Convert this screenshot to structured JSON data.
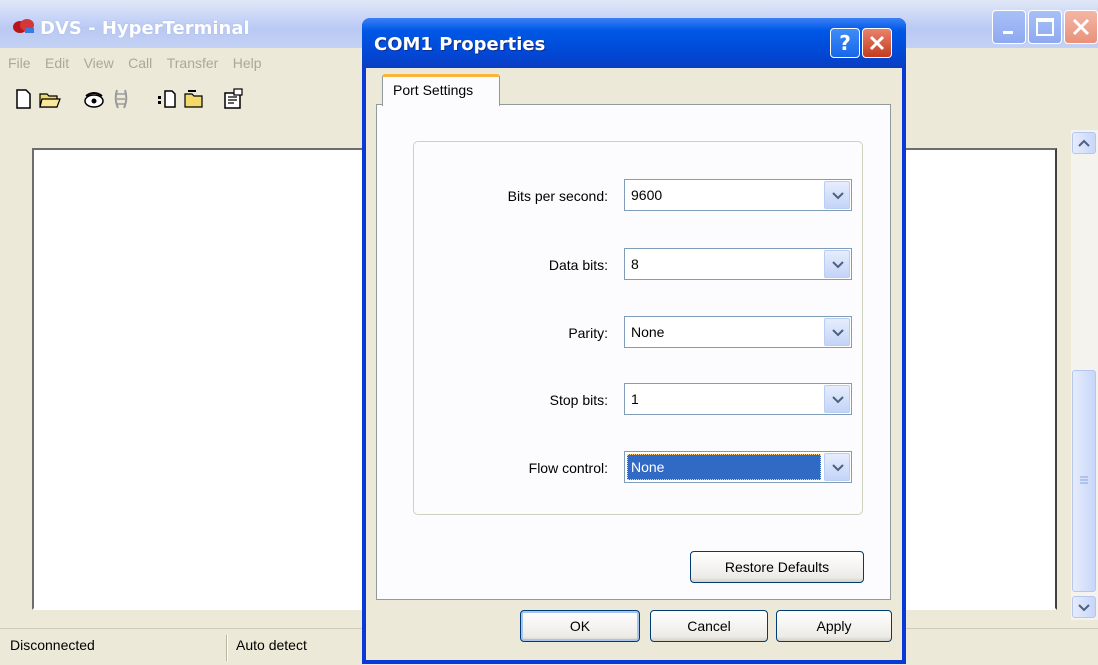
{
  "background_window": {
    "title": "DVS - HyperTerminal",
    "menu": [
      "File",
      "Edit",
      "View",
      "Call",
      "Transfer",
      "Help"
    ],
    "toolbar_icons": [
      "new-icon",
      "open-icon",
      "connect-icon",
      "disconnect-icon",
      "send-icon",
      "receive-icon",
      "properties-icon"
    ],
    "status": {
      "connection": "Disconnected",
      "detect": "Auto detect"
    }
  },
  "dialog": {
    "title": "COM1 Properties",
    "help_button": "?",
    "tab": "Port Settings",
    "fields": [
      {
        "label": "Bits per second:",
        "value": "9600"
      },
      {
        "label": "Data bits:",
        "value": "8"
      },
      {
        "label": "Parity:",
        "value": "None"
      },
      {
        "label": "Stop bits:",
        "value": "1"
      },
      {
        "label": "Flow control:",
        "value": "None"
      }
    ],
    "restore_button": "Restore Defaults",
    "ok_button": "OK",
    "cancel_button": "Cancel",
    "apply_button": "Apply"
  },
  "colors": {
    "xp_blue_title": "#0058e6",
    "selection": "#316ac5",
    "tab_accent": "#f9b53b",
    "dialog_face": "#ece9d8"
  }
}
